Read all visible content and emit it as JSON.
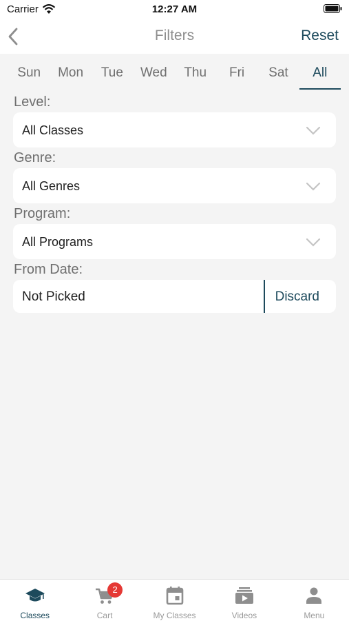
{
  "status_bar": {
    "carrier": "Carrier",
    "time": "12:27 AM"
  },
  "header": {
    "title": "Filters",
    "reset_label": "Reset"
  },
  "day_tabs": [
    {
      "label": "Sun"
    },
    {
      "label": "Mon"
    },
    {
      "label": "Tue"
    },
    {
      "label": "Wed"
    },
    {
      "label": "Thu"
    },
    {
      "label": "Fri"
    },
    {
      "label": "Sat"
    },
    {
      "label": "All",
      "selected": true
    }
  ],
  "filters": {
    "level": {
      "label": "Level:",
      "value": "All Classes"
    },
    "genre": {
      "label": "Genre:",
      "value": "All Genres"
    },
    "program": {
      "label": "Program:",
      "value": "All Programs"
    },
    "from_date": {
      "label": "From Date:",
      "value": "Not Picked",
      "discard_label": "Discard"
    }
  },
  "tab_bar": {
    "items": [
      {
        "label": "Classes",
        "icon": "graduation-cap-icon",
        "active": true
      },
      {
        "label": "Cart",
        "icon": "cart-icon",
        "badge": "2"
      },
      {
        "label": "My Classes",
        "icon": "calendar-icon"
      },
      {
        "label": "Videos",
        "icon": "video-library-icon"
      },
      {
        "label": "Menu",
        "icon": "person-icon"
      }
    ]
  },
  "colors": {
    "accent": "#1d4a5c",
    "badge": "#e53935",
    "background": "#f4f4f4"
  }
}
